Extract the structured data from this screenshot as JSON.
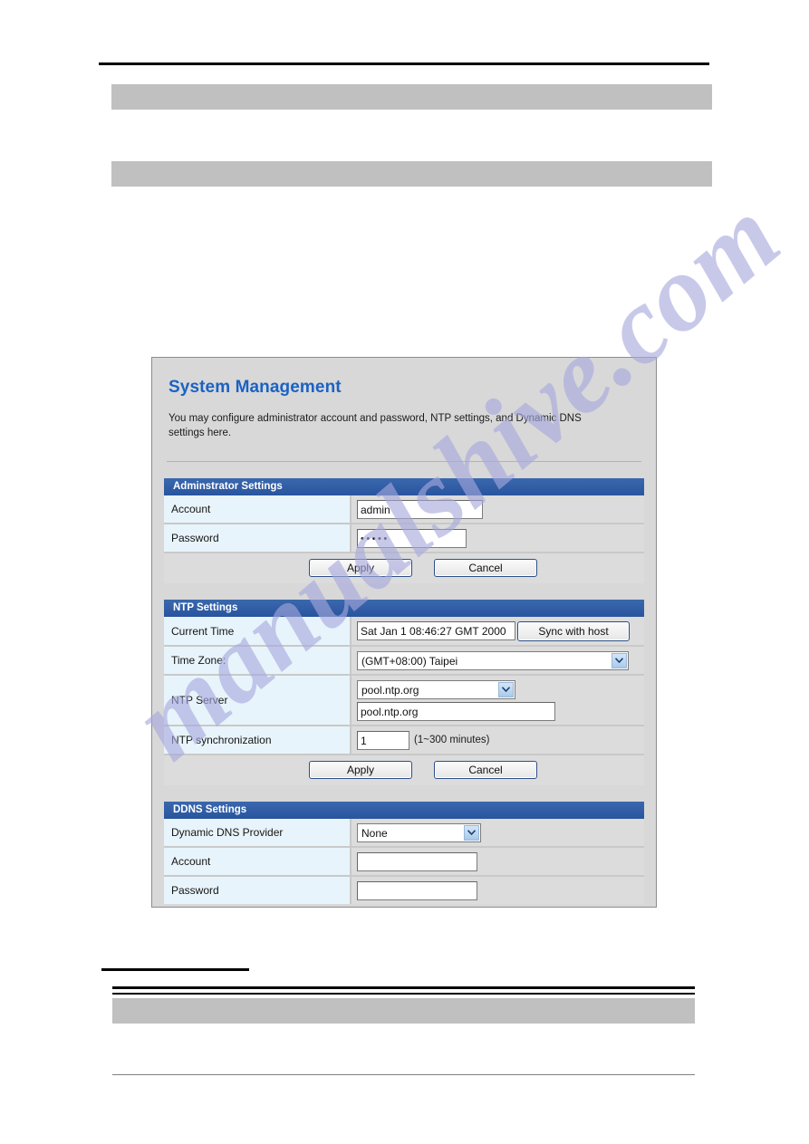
{
  "document": {
    "redacted_bars": [
      "",
      "",
      ""
    ]
  },
  "panel": {
    "title": "System Management",
    "description": "You may configure administrator account and password, NTP settings, and Dynamic DNS settings here."
  },
  "watermark": {
    "text": "manualshive.com"
  },
  "admin_section": {
    "header": "Adminstrator Settings",
    "account_label": "Account",
    "account_value": "admin",
    "password_label": "Password",
    "password_value": "•••••",
    "apply_label": "Apply",
    "cancel_label": "Cancel"
  },
  "ntp_section": {
    "header": "NTP Settings",
    "current_time_label": "Current Time",
    "current_time_value": "Sat Jan  1 08:46:27 GMT 2000",
    "sync_button_label": "Sync with host",
    "time_zone_label": "Time Zone:",
    "time_zone_value": "(GMT+08:00) Taipei",
    "ntp_server_label": "NTP Server",
    "ntp_server_select_value": "pool.ntp.org",
    "ntp_server_text_value": "pool.ntp.org",
    "sync_interval_label": "NTP synchronization",
    "sync_interval_value": "1",
    "sync_interval_hint": "(1~300 minutes)",
    "apply_label": "Apply",
    "cancel_label": "Cancel"
  },
  "ddns_section": {
    "header": "DDNS Settings",
    "provider_label": "Dynamic DNS Provider",
    "provider_value": "None",
    "account_label": "Account",
    "account_value": "",
    "password_label": "Password",
    "password_value": ""
  },
  "colors": {
    "accent_blue": "#2f5fa8",
    "title_blue": "#1a62c4",
    "label_bg": "#e8f4fb",
    "panel_bg": "#d8d8d8",
    "watermark": "#a7a9dd",
    "doc_bar": "#c0c0c0"
  }
}
